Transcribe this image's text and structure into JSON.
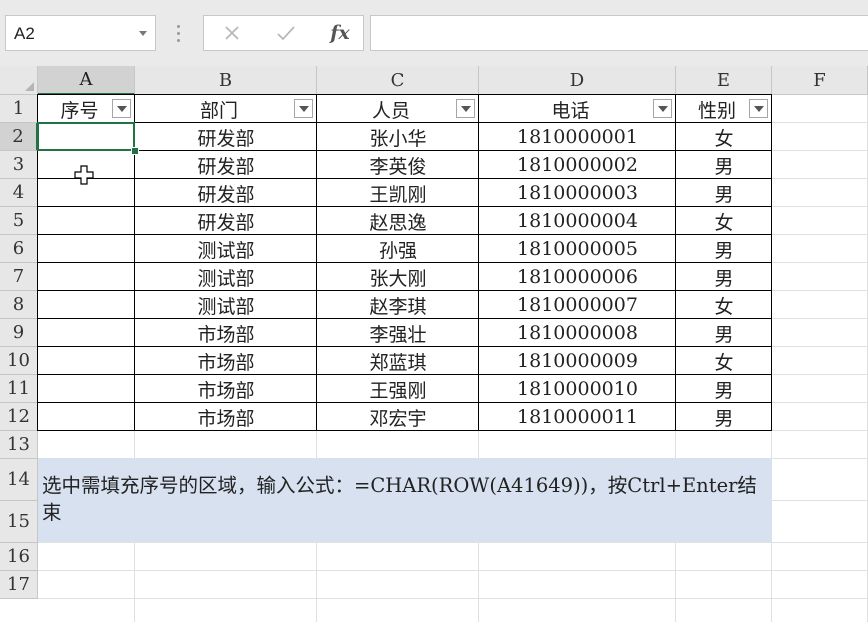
{
  "formula_bar": {
    "name_box": "A2",
    "cancel_icon": "close-icon",
    "enter_icon": "check-icon",
    "fx_label": "fx",
    "formula": ""
  },
  "columns": [
    "A",
    "B",
    "C",
    "D",
    "E",
    "F"
  ],
  "rows": [
    "1",
    "2",
    "3",
    "4",
    "5",
    "6",
    "7",
    "8",
    "9",
    "10",
    "11",
    "12",
    "13",
    "14",
    "15",
    "16",
    "17"
  ],
  "table": {
    "headers": [
      "序号",
      "部门",
      "人员",
      "电话",
      "性别"
    ],
    "records": [
      {
        "no": "",
        "dept": "研发部",
        "name": "张小华",
        "phone": "1810000001",
        "gender": "女"
      },
      {
        "no": "",
        "dept": "研发部",
        "name": "李英俊",
        "phone": "1810000002",
        "gender": "男"
      },
      {
        "no": "",
        "dept": "研发部",
        "name": "王凯刚",
        "phone": "1810000003",
        "gender": "男"
      },
      {
        "no": "",
        "dept": "研发部",
        "name": "赵思逸",
        "phone": "1810000004",
        "gender": "女"
      },
      {
        "no": "",
        "dept": "测试部",
        "name": "孙强",
        "phone": "1810000005",
        "gender": "男"
      },
      {
        "no": "",
        "dept": "测试部",
        "name": "张大刚",
        "phone": "1810000006",
        "gender": "男"
      },
      {
        "no": "",
        "dept": "测试部",
        "name": "赵李琪",
        "phone": "1810000007",
        "gender": "女"
      },
      {
        "no": "",
        "dept": "市场部",
        "name": "李强壮",
        "phone": "1810000008",
        "gender": "男"
      },
      {
        "no": "",
        "dept": "市场部",
        "name": "郑蓝琪",
        "phone": "1810000009",
        "gender": "女"
      },
      {
        "no": "",
        "dept": "市场部",
        "name": "王强刚",
        "phone": "1810000010",
        "gender": "男"
      },
      {
        "no": "",
        "dept": "市场部",
        "name": "邓宏宇",
        "phone": "1810000011",
        "gender": "男"
      }
    ]
  },
  "note": "选中需填充序号的区域，输入公式：=CHAR(ROW(A41649))，按Ctrl+Enter结束",
  "selection": {
    "active_cell": "A2",
    "selected_column": "A",
    "selected_row": "2"
  },
  "colors": {
    "accent": "#217346",
    "note_fill": "#d7e1f0",
    "header_fill": "#e7e7e7"
  }
}
